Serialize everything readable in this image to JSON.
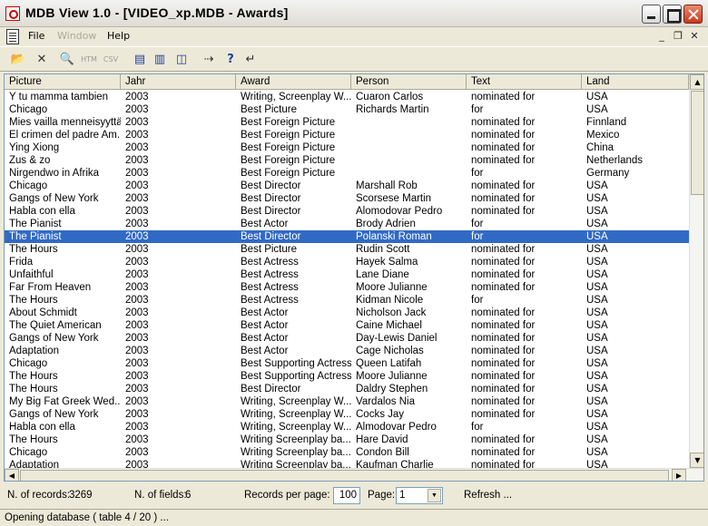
{
  "window": {
    "title": "MDB View 1.0 - [VIDEO_xp.MDB - Awards]"
  },
  "menu": {
    "file": "File",
    "window": "Window",
    "help": "Help",
    "mdi_min": "_",
    "mdi_restore": "❐",
    "mdi_close": "✕"
  },
  "toolbar": {
    "open": "📂",
    "close": "✕",
    "find": "🔍",
    "htm": "HTM",
    "csv": "CSV",
    "tile": "▤",
    "cascade": "▥",
    "split": "◫",
    "arrange": "⇢",
    "whatsthis": "?",
    "back": "↵"
  },
  "grid": {
    "columns": [
      "Picture",
      "Jahr",
      "Award",
      "Person",
      "Text",
      "Land"
    ],
    "selected_row": 11,
    "rows": [
      [
        "Y tu mamma tambien",
        "2003",
        "Writing, Screenplay W...",
        "Cuaron Carlos",
        "nominated for",
        "USA"
      ],
      [
        "Chicago",
        "2003",
        "Best Picture",
        "Richards Martin",
        "for",
        "USA"
      ],
      [
        "Mies vailla menneisyyttä",
        "2003",
        "Best Foreign Picture",
        "",
        "nominated for",
        "Finnland"
      ],
      [
        "El crimen del padre Am...",
        "2003",
        "Best Foreign Picture",
        "",
        "nominated for",
        "Mexico"
      ],
      [
        "Ying Xiong",
        "2003",
        "Best Foreign Picture",
        "",
        "nominated for",
        "China"
      ],
      [
        "Zus & zo",
        "2003",
        "Best Foreign Picture",
        "",
        "nominated for",
        "Netherlands"
      ],
      [
        "Nirgendwo in Afrika",
        "2003",
        "Best Foreign Picture",
        "",
        "for",
        "Germany"
      ],
      [
        "Chicago",
        "2003",
        "Best Director",
        "Marshall Rob",
        "nominated for",
        "USA"
      ],
      [
        "Gangs of New York",
        "2003",
        "Best Director",
        "Scorsese Martin",
        "nominated for",
        "USA"
      ],
      [
        "Habla con ella",
        "2003",
        "Best Director",
        "Alomodovar Pedro",
        "nominated for",
        "USA"
      ],
      [
        "The Pianist",
        "2003",
        "Best Actor",
        "Brody Adrien",
        "for",
        "USA"
      ],
      [
        "The Pianist",
        "2003",
        "Best Director",
        "Polanski Roman",
        "for",
        "USA"
      ],
      [
        "The Hours",
        "2003",
        "Best Picture",
        "Rudin Scott",
        "nominated for",
        "USA"
      ],
      [
        "Frida",
        "2003",
        "Best Actress",
        "Hayek Salma",
        "nominated for",
        "USA"
      ],
      [
        "Unfaithful",
        "2003",
        "Best Actress",
        "Lane Diane",
        "nominated for",
        "USA"
      ],
      [
        "Far From Heaven",
        "2003",
        "Best Actress",
        "Moore Julianne",
        "nominated for",
        "USA"
      ],
      [
        "The Hours",
        "2003",
        "Best Actress",
        "Kidman Nicole",
        "for",
        "USA"
      ],
      [
        "About Schmidt",
        "2003",
        "Best Actor",
        "Nicholson Jack",
        "nominated for",
        "USA"
      ],
      [
        "The Quiet American",
        "2003",
        "Best Actor",
        "Caine Michael",
        "nominated for",
        "USA"
      ],
      [
        "Gangs of New York",
        "2003",
        "Best Actor",
        "Day-Lewis Daniel",
        "nominated for",
        "USA"
      ],
      [
        "Adaptation",
        "2003",
        "Best Actor",
        "Cage Nicholas",
        "nominated for",
        "USA"
      ],
      [
        "Chicago",
        "2003",
        "Best Supporting Actress",
        "Queen Latifah",
        "nominated for",
        "USA"
      ],
      [
        "The Hours",
        "2003",
        "Best Supporting Actress",
        "Moore Julianne",
        "nominated for",
        "USA"
      ],
      [
        "The Hours",
        "2003",
        "Best Director",
        "Daldry Stephen",
        "nominated for",
        "USA"
      ],
      [
        "My Big Fat Greek Wed...",
        "2003",
        "Writing, Screenplay W...",
        "Vardalos Nia",
        "nominated for",
        "USA"
      ],
      [
        "Gangs of New York",
        "2003",
        "Writing, Screenplay W...",
        "Cocks Jay",
        "nominated for",
        "USA"
      ],
      [
        "Habla con ella",
        "2003",
        "Writing, Screenplay W...",
        "Almodovar Pedro",
        "for",
        "USA"
      ],
      [
        "The Hours",
        "2003",
        "Writing Screenplay ba...",
        "Hare David",
        "nominated for",
        "USA"
      ],
      [
        "Chicago",
        "2003",
        "Writing Screenplay ba...",
        "Condon Bill",
        "nominated for",
        "USA"
      ],
      [
        "Adaptation",
        "2003",
        "Writing Screenplay ba...",
        "Kaufman Charlie",
        "nominated for",
        "USA"
      ]
    ]
  },
  "footer": {
    "records_label": "N. of records:",
    "records_value": "3269",
    "fields_label": "N. of fields:",
    "fields_value": "6",
    "rpp_label": "Records per page:",
    "rpp_value": "100",
    "page_label": "Page:",
    "page_value": "1",
    "refresh": "Refresh ..."
  },
  "status": {
    "text": "Opening database ( table 4 / 20 ) ..."
  }
}
